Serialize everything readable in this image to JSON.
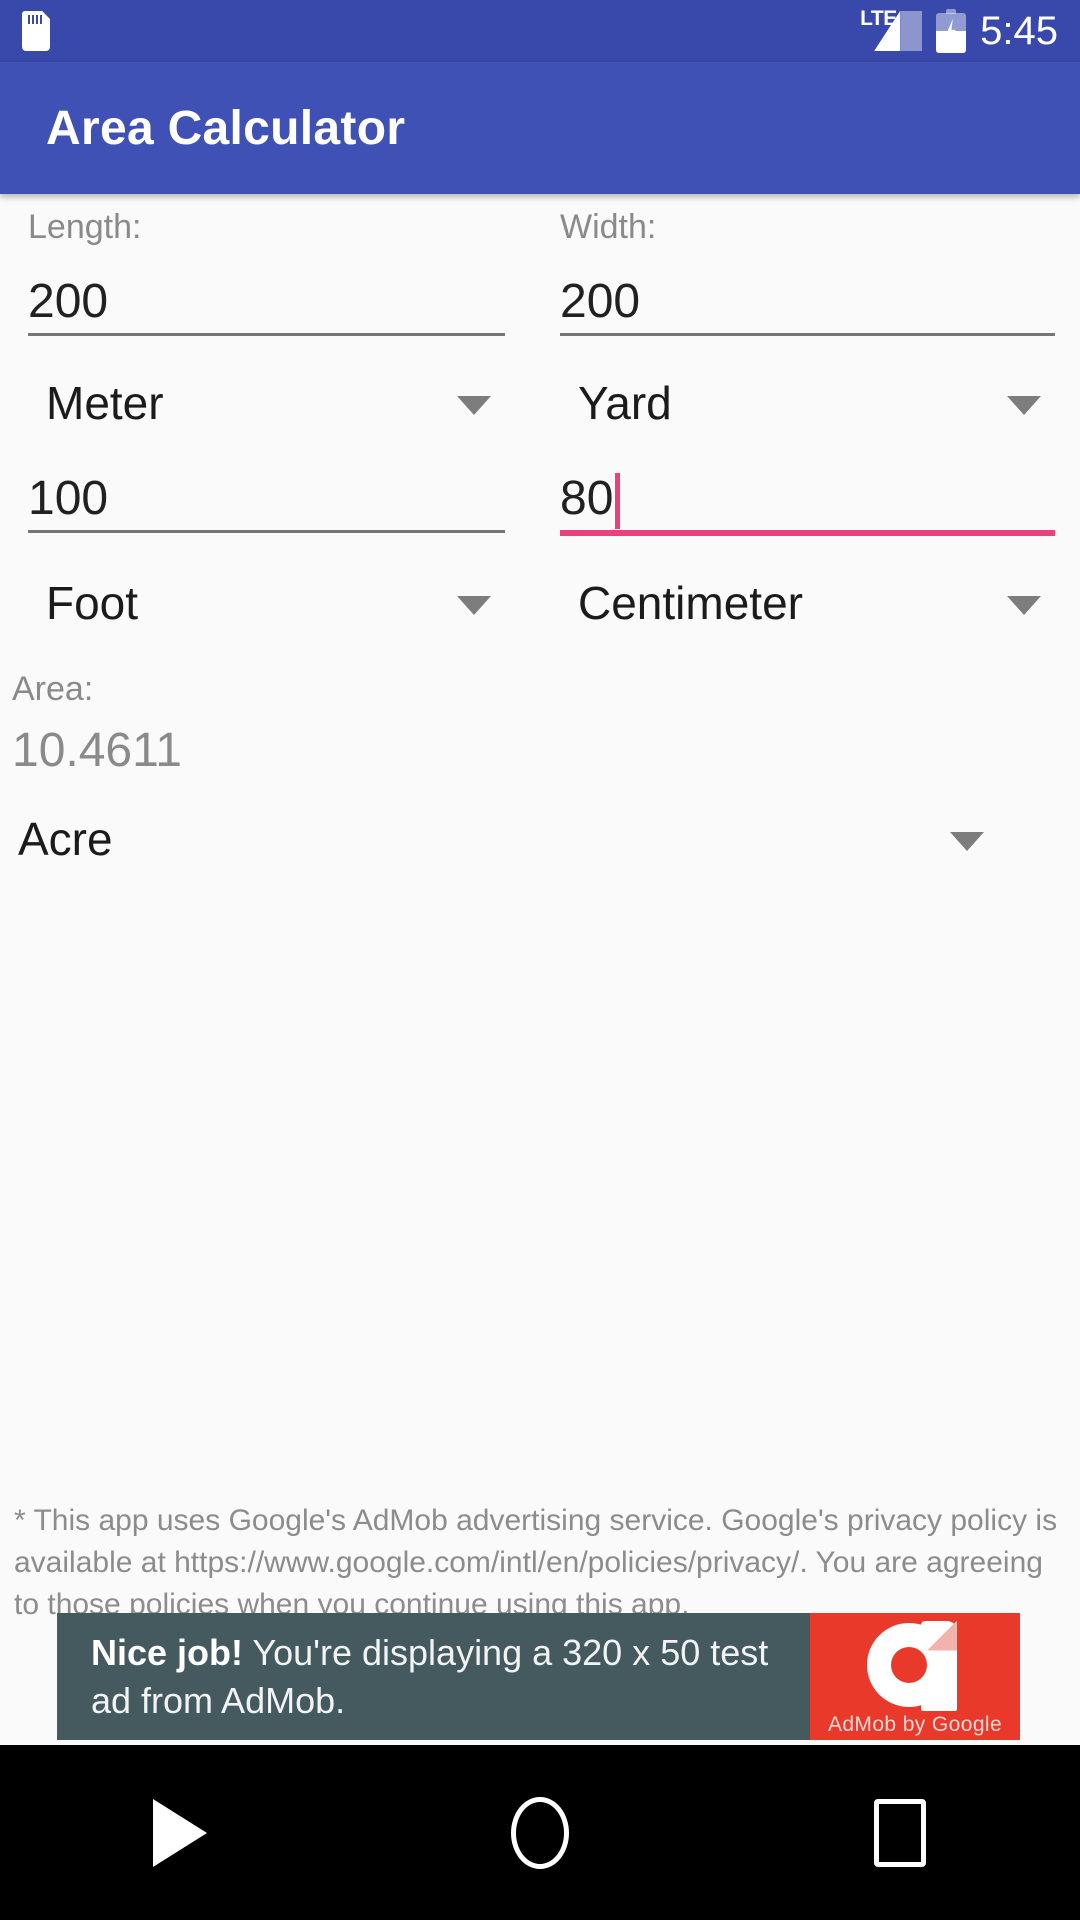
{
  "status_bar": {
    "sd_card_icon": "sd-card-icon",
    "network_label": "LTE",
    "signal_icon": "signal-bars-icon",
    "battery_icon": "battery-charging-icon",
    "time": "5:45"
  },
  "app_bar": {
    "title": "Area Calculator"
  },
  "form": {
    "length": {
      "label": "Length:",
      "primary_value": "200",
      "primary_unit": "Meter",
      "secondary_value": "100",
      "secondary_unit": "Foot"
    },
    "width": {
      "label": "Width:",
      "primary_value": "200",
      "primary_unit": "Yard",
      "secondary_value": "80",
      "secondary_unit": "Centimeter"
    },
    "focused_field": "width-secondary-input",
    "accent_focus_color": "#ec407a"
  },
  "result": {
    "label": "Area:",
    "value": "10.4611",
    "unit": "Acre"
  },
  "disclaimer": {
    "text": "* This app uses Google's AdMob advertising service. Google's privacy policy is available at https://www.google.com/intl/en/policies/privacy/. You are agreeing to those policies when you continue using this app."
  },
  "ad": {
    "headline": "Nice job!",
    "body": " You're displaying a 320 x 50 test ad from AdMob.",
    "logo_caption": "AdMob by Google",
    "logo_icon": "admob-logo-icon",
    "background_color": "#455a5f",
    "logo_background_color": "#e8392b"
  },
  "nav_bar": {
    "back_label": "Back",
    "home_label": "Home",
    "recents_label": "Recent apps"
  },
  "theme": {
    "status_bar_color": "#3949ab",
    "app_bar_color": "#3f51b5",
    "page_background": "#fafafa"
  }
}
